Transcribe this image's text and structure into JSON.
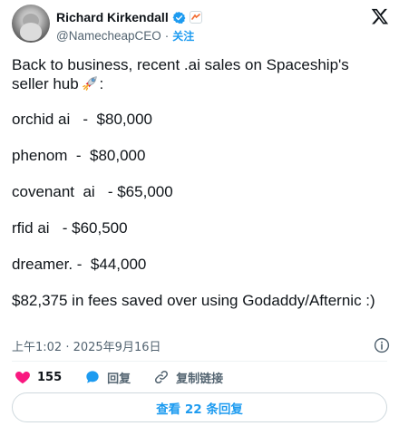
{
  "author": {
    "display_name": "Richard Kirkendall",
    "handle": "@NamecheapCEO",
    "separator": "·",
    "follow_label": "关注"
  },
  "tweet": {
    "lines": [
      "Back to business, recent .ai sales on Spaceship's",
      "seller hub",
      "orchid ai   -  $80,000",
      "phenom  -  $80,000",
      "covenant  ai   - $65,000",
      "rfid ai   - $60,500",
      "dreamer. -  $44,000",
      "$82,375 in fees saved over using Godaddy/Afternic :)"
    ],
    "emoji": "rocket-icon"
  },
  "timestamp": "上午1:02 · 2025年9月16日",
  "actions": {
    "like_count": "155",
    "reply_label": "回复",
    "copy_link_label": "复制链接"
  },
  "read_replies_label": "查看 22 条回复",
  "colors": {
    "accent": "#1d9bf0",
    "like": "#f91880",
    "text": "#0f1419",
    "secondary": "#536471"
  }
}
